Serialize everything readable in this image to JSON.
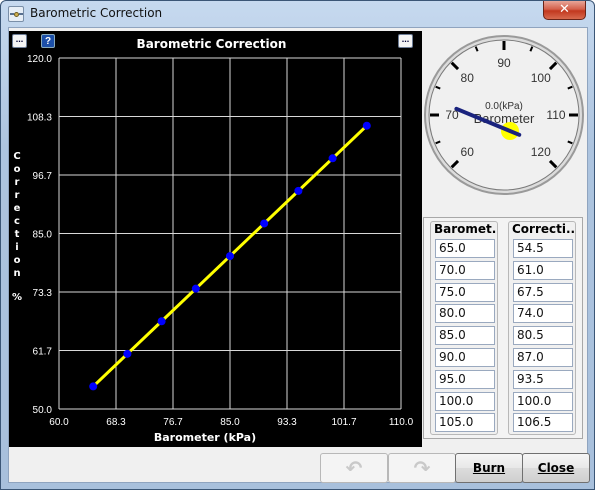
{
  "window": {
    "title": "Barometric Correction",
    "close_glyph": "✕"
  },
  "chart_panel": {
    "menu_glyph": "...",
    "help_glyph": "?",
    "title": "Barometric Correction"
  },
  "chart_data": {
    "type": "line",
    "title": "Barometric Correction",
    "xlabel": "Barometer (kPa)",
    "ylabel": "Correction %",
    "xlim": [
      60.0,
      110.0
    ],
    "ylim": [
      50.0,
      120.0
    ],
    "x_ticks": [
      "60.0",
      "68.3",
      "76.7",
      "85.0",
      "93.3",
      "101.7",
      "110.0"
    ],
    "y_ticks": [
      "50.0",
      "61.7",
      "73.3",
      "85.0",
      "96.7",
      "108.3",
      "120.0"
    ],
    "x": [
      65.0,
      70.0,
      75.0,
      80.0,
      85.0,
      90.0,
      95.0,
      100.0,
      105.0
    ],
    "y": [
      54.5,
      61.0,
      67.5,
      74.0,
      80.5,
      87.0,
      93.5,
      100.0,
      106.5
    ],
    "line_color": "#ffff00",
    "point_color": "#0000ff",
    "grid": true
  },
  "gauge": {
    "label": "Barometer",
    "value_text": "0.0(kPa)",
    "min": 60,
    "max": 120,
    "value": 0,
    "tick_labels": [
      "60",
      "70",
      "80",
      "90",
      "100",
      "110",
      "120"
    ],
    "needle_color": "#1a237e",
    "hub_color": "#ffff00"
  },
  "table": {
    "headers": [
      "Baromet...",
      "Correcti..."
    ],
    "barometer": [
      "65.0",
      "70.0",
      "75.0",
      "80.0",
      "85.0",
      "90.0",
      "95.0",
      "100.0",
      "105.0"
    ],
    "correction": [
      "54.5",
      "61.0",
      "67.5",
      "74.0",
      "80.5",
      "87.0",
      "93.5",
      "100.0",
      "106.5"
    ]
  },
  "buttons": {
    "undo_icon": "undo-icon",
    "redo_icon": "redo-icon",
    "burn": "Burn",
    "close": "Close"
  }
}
